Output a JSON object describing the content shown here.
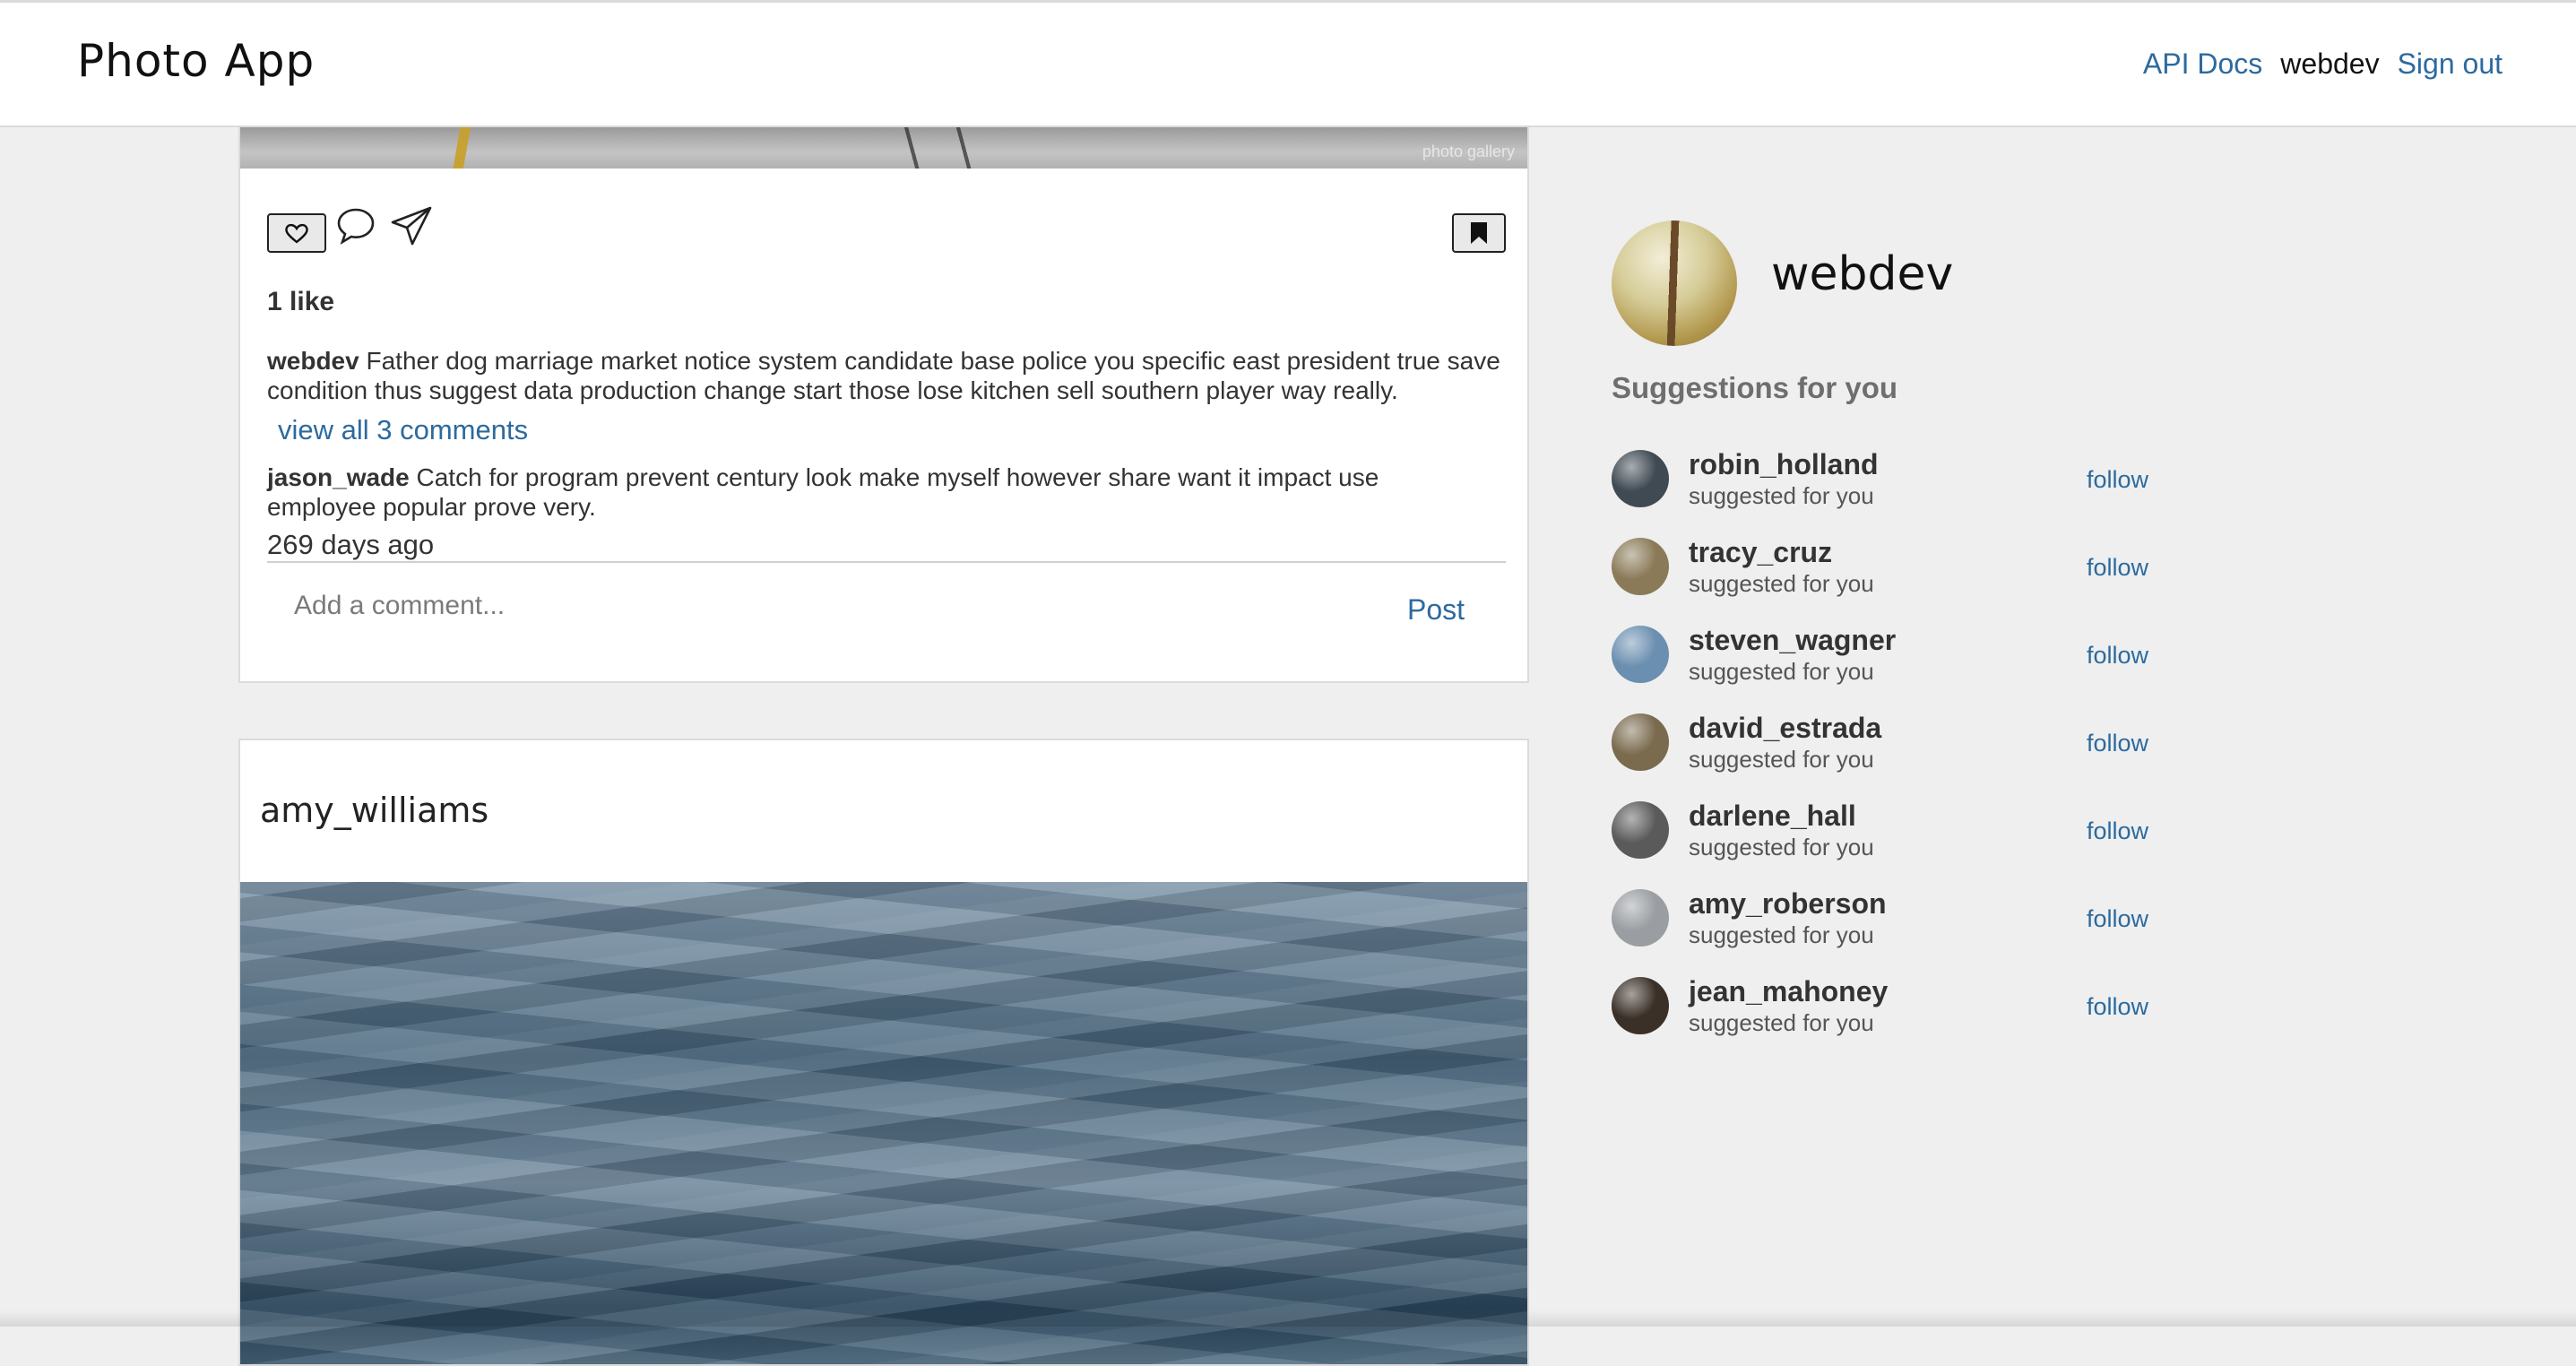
{
  "app": {
    "title": "Photo App"
  },
  "nav": {
    "api_docs": "API Docs",
    "username": "webdev",
    "sign_out": "Sign out"
  },
  "post1": {
    "watermark": "photo gallery",
    "likes": "1 like",
    "caption_user": "webdev",
    "caption_text": "Father dog marriage market notice system candidate base police you specific east president true save condition thus suggest data production change start those lose kitchen sell southern player way really.",
    "view_all": "view all 3 comments",
    "comment_user": "jason_wade",
    "comment_text": "Catch for program prevent century look make myself however share want it impact use employee popular prove very.",
    "time_ago": "269 days ago",
    "comment_placeholder": "Add a comment...",
    "post_label": "Post",
    "icons": [
      "heart-icon",
      "comment-bubble-icon",
      "send-paper-plane-icon",
      "bookmark-icon"
    ]
  },
  "post2": {
    "username": "amy_williams"
  },
  "sidebar": {
    "profile_name": "webdev",
    "suggestions_title": "Suggestions for you",
    "suggestions": [
      {
        "name": "robin_holland",
        "subtitle": "suggested for you",
        "action": "follow",
        "avatar_color": "#3f4a52"
      },
      {
        "name": "tracy_cruz",
        "subtitle": "suggested for you",
        "action": "follow",
        "avatar_color": "#8a7a58"
      },
      {
        "name": "steven_wagner",
        "subtitle": "suggested for you",
        "action": "follow",
        "avatar_color": "#6b8fb0"
      },
      {
        "name": "david_estrada",
        "subtitle": "suggested for you",
        "action": "follow",
        "avatar_color": "#7a6a4e"
      },
      {
        "name": "darlene_hall",
        "subtitle": "suggested for you",
        "action": "follow",
        "avatar_color": "#5a5a5a"
      },
      {
        "name": "amy_roberson",
        "subtitle": "suggested for you",
        "action": "follow",
        "avatar_color": "#9a9ea2"
      },
      {
        "name": "jean_mahoney",
        "subtitle": "suggested for you",
        "action": "follow",
        "avatar_color": "#3a3028"
      }
    ]
  }
}
